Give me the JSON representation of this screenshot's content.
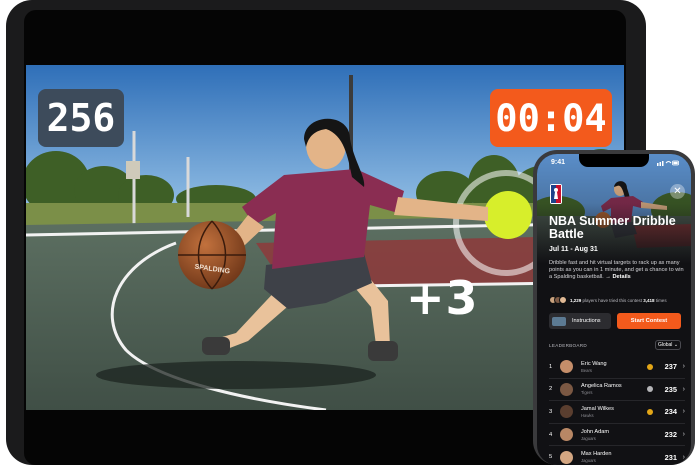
{
  "game_screen": {
    "score": "256",
    "timer": "00:04",
    "points_popup": "+3",
    "ball_brand": "SPALDING"
  },
  "phone_app": {
    "status_time": "9:41",
    "contest": {
      "title": "NBA Summer Dribble Battle",
      "dates": "Jul 11 - Aug 31",
      "description": "Dribble fast and hit virtual targets to rack up as many points as you can in 1 minute, and get a chance to win a Spalding basketball.",
      "details_link": "→ Details",
      "players_count": "1,229",
      "players_text_mid": " players have tried this contest ",
      "tries_count": "3,418",
      "tries_suffix": " times"
    },
    "buttons": {
      "instructions": "Instructions",
      "start": "Start Contest"
    },
    "leaderboard": {
      "title": "LEADERBOARD",
      "filter": "Global",
      "rows": [
        {
          "rank": "1",
          "name": "Eric Wang",
          "team": "Bears",
          "score": "237",
          "medal": "gold"
        },
        {
          "rank": "2",
          "name": "Angelica Ramos",
          "team": "Tigers",
          "score": "235",
          "medal": "silver"
        },
        {
          "rank": "3",
          "name": "Jamal Wilkes",
          "team": "Hawks",
          "score": "234",
          "medal": "gold"
        },
        {
          "rank": "4",
          "name": "John Adam",
          "team": "Jaguars",
          "score": "232",
          "medal": "none"
        },
        {
          "rank": "5",
          "name": "Max Harden",
          "team": "Jaguars",
          "score": "231",
          "medal": "none"
        }
      ]
    },
    "colors": {
      "accent": "#f35a1c",
      "gold": "#e3a617",
      "silver": "#b5b5b8",
      "bronze": "#c2772e"
    }
  }
}
